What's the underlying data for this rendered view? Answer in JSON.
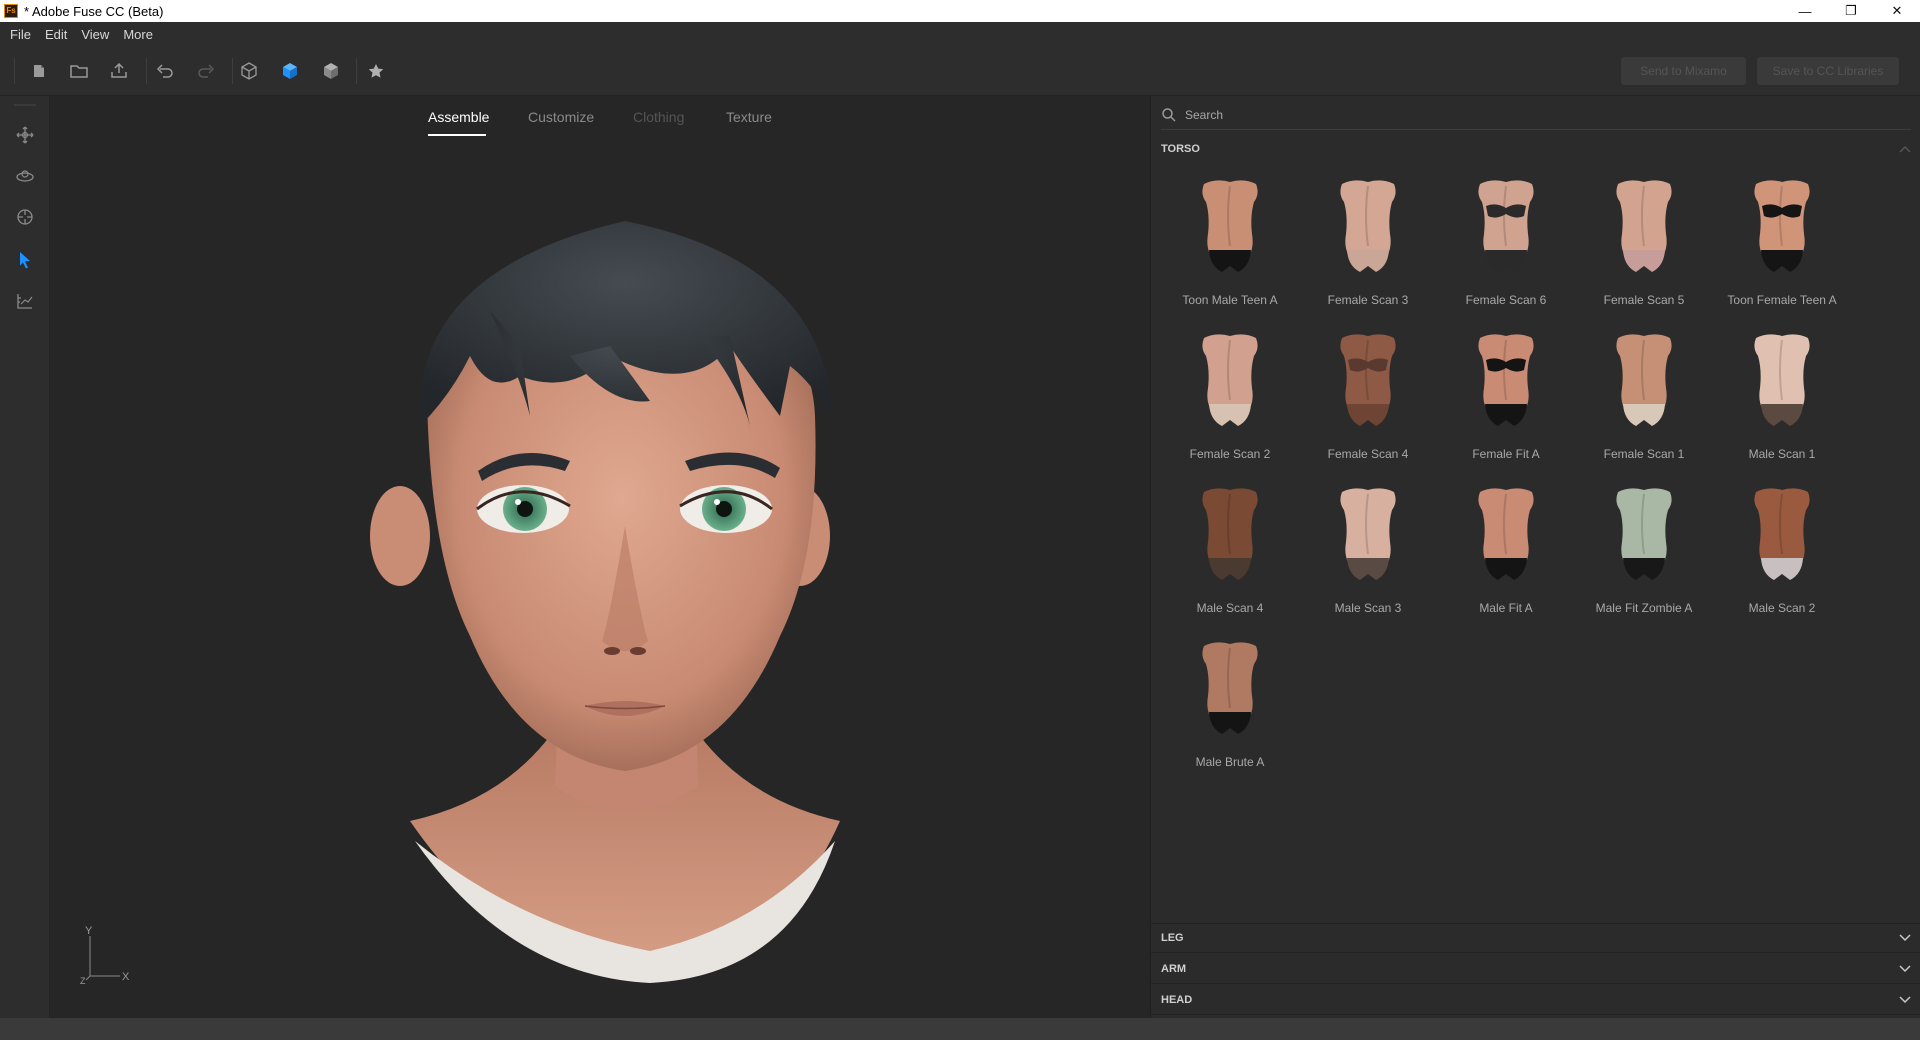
{
  "window": {
    "title": "* Adobe Fuse CC (Beta)",
    "app_badge": "Fs"
  },
  "menu": [
    "File",
    "Edit",
    "View",
    "More"
  ],
  "toolbar": {
    "send_mixamo_label": "Send to Mixamo",
    "save_cc_label": "Save to CC Libraries"
  },
  "tabs": [
    {
      "label": "Assemble",
      "state": "active"
    },
    {
      "label": "Customize",
      "state": "normal"
    },
    {
      "label": "Clothing",
      "state": "disabled"
    },
    {
      "label": "Texture",
      "state": "normal"
    }
  ],
  "gizmo": {
    "y": "Y",
    "z": "Z",
    "x": "X"
  },
  "search": {
    "placeholder": "Search"
  },
  "sections": {
    "torso": "TORSO",
    "leg": "LEG",
    "arm": "ARM",
    "head": "HEAD"
  },
  "items": [
    {
      "label": "Toon Male Teen A",
      "skin": "#c98f74",
      "bottom": "#141414",
      "top": null
    },
    {
      "label": "Female Scan 3",
      "skin": "#d3a793",
      "bottom": "#c9a696",
      "top": null
    },
    {
      "label": "Female Scan 6",
      "skin": "#d0a391",
      "bottom": "#2a2a2a",
      "top": "#2a2a2a"
    },
    {
      "label": "Female Scan 5",
      "skin": "#d2a490",
      "bottom": "#c79d9a",
      "top": null
    },
    {
      "label": "Toon Female Teen A",
      "skin": "#d09479",
      "bottom": "#151515",
      "top": "#151515"
    },
    {
      "label": "Female Scan 2",
      "skin": "#d1a08e",
      "bottom": "#d7c1b0",
      "top": null
    },
    {
      "label": "Female Scan 4",
      "skin": "#8f5a45",
      "bottom": "#6e4535",
      "top": "#5a3a30"
    },
    {
      "label": "Female Fit A",
      "skin": "#c98b74",
      "bottom": "#141414",
      "top": "#141414"
    },
    {
      "label": "Female Scan 1",
      "skin": "#c59076",
      "bottom": "#d8c8b8",
      "top": null
    },
    {
      "label": "Male Scan 1",
      "skin": "#e0c0b0",
      "bottom": "#5a4a40",
      "top": null
    },
    {
      "label": "Male Scan 4",
      "skin": "#7a4a35",
      "bottom": "#4a3a30",
      "top": null
    },
    {
      "label": "Male Scan 3",
      "skin": "#d8b0a0",
      "bottom": "#5a4a44",
      "top": null
    },
    {
      "label": "Male Fit A",
      "skin": "#c98b74",
      "bottom": "#141414",
      "top": null
    },
    {
      "label": "Male Fit Zombie A",
      "skin": "#a9b8a5",
      "bottom": "#181818",
      "top": null
    },
    {
      "label": "Male Scan 2",
      "skin": "#9a5a40",
      "bottom": "#c8c0c0",
      "top": null
    },
    {
      "label": "Male Brute A",
      "skin": "#b07a62",
      "bottom": "#141414",
      "top": null
    }
  ],
  "colors": {
    "accent": "#1e90ff",
    "skin": "#d9a08a",
    "hair": "#2e3338",
    "eye": "#4a9e7a"
  }
}
